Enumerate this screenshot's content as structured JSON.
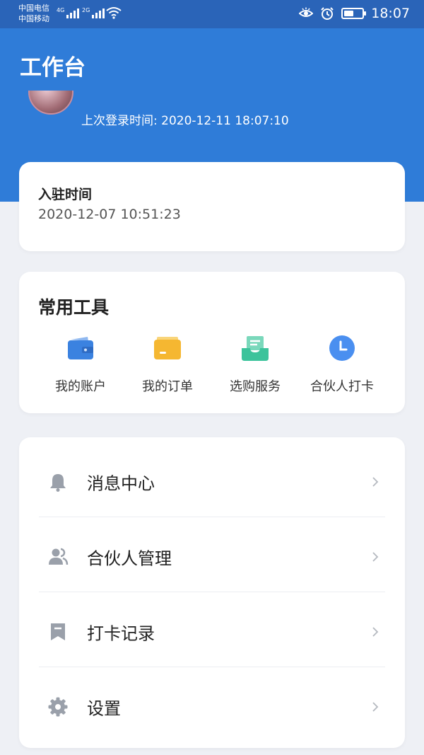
{
  "status_bar": {
    "carrier1": "中国电信",
    "carrier2": "中国移动",
    "net1": "4G",
    "net2": "2G",
    "time": "18:07"
  },
  "header": {
    "title": "工作台"
  },
  "profile": {
    "name_partial": "",
    "last_login": "上次登录时间: 2020-12-11 18:07:10"
  },
  "join_card": {
    "label": "入驻时间",
    "value": "2020-12-07 10:51:23"
  },
  "tools": {
    "title": "常用工具",
    "items": [
      {
        "label": "我的账户",
        "icon": "wallet-icon",
        "color": "#3b82e0"
      },
      {
        "label": "我的订单",
        "icon": "folder-icon",
        "color": "#f5b731"
      },
      {
        "label": "选购服务",
        "icon": "inbox-icon",
        "color": "#3cc39b"
      },
      {
        "label": "合伙人打卡",
        "icon": "clock-icon",
        "color": "#4a8ff0"
      }
    ]
  },
  "menu": {
    "items": [
      {
        "label": "消息中心",
        "icon": "bell-icon"
      },
      {
        "label": "合伙人管理",
        "icon": "users-icon"
      },
      {
        "label": "打卡记录",
        "icon": "bookmark-icon"
      },
      {
        "label": "设置",
        "icon": "gear-icon"
      }
    ]
  },
  "colors": {
    "header_blue": "#2f7cd8",
    "status_bar": "#2a64b8",
    "background": "#eef0f5",
    "menu_icon_gray": "#9aa0aa"
  }
}
